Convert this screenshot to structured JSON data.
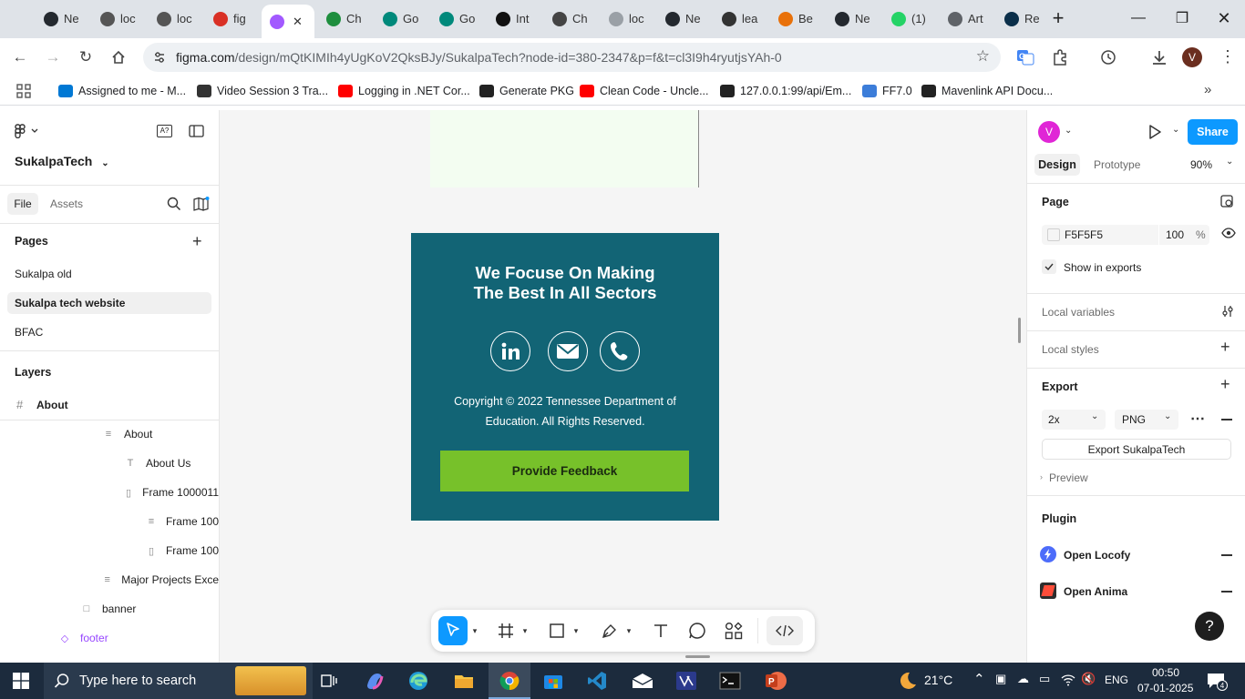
{
  "browser": {
    "tabs": [
      {
        "label": "Ne",
        "icon": "github-icon",
        "color": "#24292f"
      },
      {
        "label": "loc",
        "icon": "app-icon",
        "color": "#555555"
      },
      {
        "label": "loc",
        "icon": "app-icon",
        "color": "#555555"
      },
      {
        "label": "fig",
        "icon": "gmail-icon",
        "color": "#d93025"
      },
      {
        "label": "",
        "icon": "figma-icon",
        "color": "#a259ff",
        "active": true
      },
      {
        "label": "Ch",
        "icon": "google-chat-icon",
        "color": "#1e8e3e"
      },
      {
        "label": "Go",
        "icon": "google-meet-icon",
        "color": "#00897b"
      },
      {
        "label": "Go",
        "icon": "google-meet-icon",
        "color": "#00897b"
      },
      {
        "label": "Int",
        "icon": "openai-icon",
        "color": "#111111"
      },
      {
        "label": "Ch",
        "icon": "openai-icon",
        "color": "#444444"
      },
      {
        "label": "loc",
        "icon": "globe-icon",
        "color": "#9aa0a6"
      },
      {
        "label": "Ne",
        "icon": "github-icon",
        "color": "#24292f"
      },
      {
        "label": "lea",
        "icon": "app-icon",
        "color": "#333333"
      },
      {
        "label": "Be",
        "icon": "app-icon",
        "color": "#e8710a"
      },
      {
        "label": "Ne",
        "icon": "github-icon",
        "color": "#24292f"
      },
      {
        "label": "(1)",
        "icon": "whatsapp-icon",
        "color": "#25d366"
      },
      {
        "label": "Art",
        "icon": "globe-icon",
        "color": "#5f6368"
      },
      {
        "label": "Re",
        "icon": "react-icon",
        "color": "#0b2f4a"
      }
    ],
    "url_domain": "figma.com",
    "url_path": "/design/mQtKIMIh4yUgKoV2QksBJy/SukalpaTech?node-id=380-2347&p=f&t=cl3I9h4ryutjsYAh-0",
    "profile_initial": "V",
    "bookmarks": [
      {
        "label": "Assigned to me - M...",
        "color": "#0078d4"
      },
      {
        "label": "Video Session 3 Tra...",
        "color": "#333333"
      },
      {
        "label": "Logging in .NET Cor...",
        "color": "#ff0000"
      },
      {
        "label": "Generate PKG",
        "color": "#222222"
      },
      {
        "label": "Clean Code - Uncle...",
        "color": "#ff0000"
      },
      {
        "label": "127.0.0.1:99/api/Em...",
        "color": "#222222"
      },
      {
        "label": "FF7.0",
        "color": "#3c7dd9"
      },
      {
        "label": "Mavenlink API Docu...",
        "color": "#222222"
      }
    ]
  },
  "left_panel": {
    "project_name": "SukalpaTech",
    "tabs": {
      "file": "File",
      "assets": "Assets"
    },
    "pages_title": "Pages",
    "pages": [
      "Sukalpa old",
      "Sukalpa tech website",
      "BFAC"
    ],
    "layers_title": "Layers",
    "current_layer": "About",
    "layers": [
      {
        "label": "About",
        "icon": "auto-layout-icon"
      },
      {
        "label": "About Us",
        "icon": "text-icon"
      },
      {
        "label": "Frame 1000011",
        "icon": "frame-icon"
      },
      {
        "label": "Frame 100",
        "icon": "auto-layout-icon"
      },
      {
        "label": "Frame 100",
        "icon": "frame-icon"
      },
      {
        "label": "Major Projects Exce",
        "icon": "auto-layout-icon"
      },
      {
        "label": "banner",
        "icon": "rectangle-icon"
      },
      {
        "label": "footer",
        "icon": "component-icon"
      }
    ]
  },
  "canvas": {
    "footer_title_line1": "We Focuse On Making",
    "footer_title_line2": "The Best In All Sectors",
    "copyright_line1": "Copyright © 2022 Tennessee Department of",
    "copyright_line2": "Education. All Rights Reserved.",
    "feedback_button": "Provide Feedback",
    "colors": {
      "footer_bg": "#126475",
      "button_bg": "#77c12a",
      "canvas_bg": "#f5f5f5"
    }
  },
  "right_panel": {
    "avatar_initial": "V",
    "share_label": "Share",
    "tabs": {
      "design": "Design",
      "prototype": "Prototype"
    },
    "zoom": "90%",
    "page_section": "Page",
    "page_color": "F5F5F5",
    "page_opacity": "100",
    "opacity_unit": "%",
    "show_in_exports": "Show in exports",
    "local_variables": "Local variables",
    "local_styles": "Local styles",
    "export_section": "Export",
    "export_scale": "2x",
    "export_format": "PNG",
    "export_button": "Export SukalpaTech",
    "preview_label": "Preview",
    "plugin_section": "Plugin",
    "plugins": [
      "Open Locofy",
      "Open Anima"
    ],
    "help_label": "?"
  },
  "taskbar": {
    "search_placeholder": "Type here to search",
    "temperature": "21°C",
    "language": "ENG",
    "time": "00:50",
    "date": "07-01-2025",
    "notification_count": "4"
  }
}
